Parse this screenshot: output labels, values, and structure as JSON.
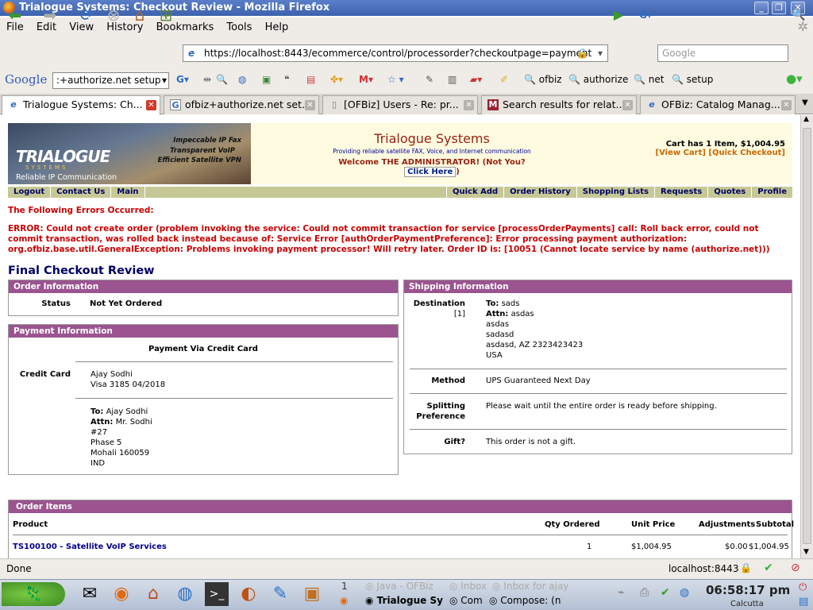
{
  "window": {
    "title": "Trialogue Systems: Checkout Review - Mozilla Firefox"
  },
  "menu": [
    "File",
    "Edit",
    "View",
    "History",
    "Bookmarks",
    "Tools",
    "Help"
  ],
  "nav": {
    "url": "https://localhost:8443/ecommerce/control/processorder?checkoutpage=payment",
    "search_placeholder": "Google"
  },
  "googlebar": {
    "logo": "Google",
    "query": ":+authorize.net setup",
    "links": [
      "ofbiz",
      "authorize",
      "net",
      "setup"
    ]
  },
  "tabs": [
    {
      "label": "Trialogue Systems: Ch...",
      "active": true
    },
    {
      "label": "ofbiz+authorize.net set...",
      "active": false
    },
    {
      "label": "[OFBiz] Users - Re: pr...",
      "active": false
    },
    {
      "label": "Search results for relat...",
      "active": false
    },
    {
      "label": "OFBiz: Catalog Manag...",
      "active": false
    }
  ],
  "page": {
    "logo": {
      "title": "TRIALOGUE",
      "sub": "SYSTEMS",
      "tagline": "Reliable IP Communication",
      "q1": "Impeccable IP Fax",
      "q2": "Transparent VoIP",
      "q3": "Efficient Satellite VPN"
    },
    "store": {
      "name": "Trialogue Systems",
      "slogan": "Providing reliable satellite FAX, Voice, and Internet communication",
      "welcome": "Welcome THE ADMINISTRATOR! (Not You?",
      "click_here": "Click Here",
      "welcome_end": ")"
    },
    "cart": {
      "summary": "Cart has 1 Item, $1,004.95",
      "links": "[View Cart] [Quick Checkout]"
    },
    "nav_left": [
      "Logout",
      "Contact Us",
      "Main"
    ],
    "nav_right": [
      "Quick Add",
      "Order History",
      "Shopping Lists",
      "Requests",
      "Quotes",
      "Profile"
    ],
    "errors_title": "The Following Errors Occurred:",
    "error_text": "ERROR: Could not create order (problem invoking the service: Could not commit transaction for service [processOrderPayments] call: Roll back error, could not commit transaction, was rolled back instead because of: Service Error [authOrderPaymentPreference]: Error processing payment authorization: org.ofbiz.base.util.GeneralException: Problems invoking payment processor! Will retry later. Order ID is: [10051 (Cannot locate service by name (authorize.net)))",
    "review_title": "Final Checkout Review",
    "order_info": {
      "header": "Order Information",
      "status_label": "Status",
      "status_value": "Not Yet Ordered"
    },
    "payment": {
      "header": "Payment Information",
      "via": "Payment Via Credit Card",
      "cc_label": "Credit Card",
      "cc_name": "Ajay  Sodhi",
      "cc_number": "Visa 3185 04/2018",
      "to_label": "To:",
      "to_name": "Ajay Sodhi",
      "attn_label": "Attn:",
      "attn_name": "Mr. Sodhi",
      "line1": "#27",
      "line2": "Phase 5",
      "line3": "Mohali 160059",
      "line4": "IND"
    },
    "shipping": {
      "header": "Shipping Information",
      "dest_label": "Destination",
      "dest_num": "[1]",
      "to_label": "To:",
      "to_name": "sads",
      "attn_label": "Attn:",
      "attn_name": "asdas",
      "line1": "asdas",
      "line2": "sadasd",
      "line3": "asdasd, AZ 2323423423",
      "line4": "USA",
      "method_label": "Method",
      "method_value": "UPS Guaranteed Next Day",
      "split_label1": "Splitting",
      "split_label2": "Preference",
      "split_value": "Please wait until the entire order is ready before shipping.",
      "gift_label": "Gift?",
      "gift_value": "This order is not a gift."
    },
    "items": {
      "header": "Order Items",
      "columns": [
        "Product",
        "Qty Ordered",
        "Unit Price",
        "Adjustments",
        "Subtotal"
      ],
      "row": {
        "product": "TS100100 - Satellite VoIP Services",
        "qty": "1",
        "unit": "$1,004.95",
        "adj": "$0.00",
        "subtotal": "$1,004.95"
      }
    }
  },
  "status": {
    "left": "Done",
    "host": "localhost:8443"
  },
  "taskbar": {
    "workspace": "1",
    "task1": "Java - OFBiz",
    "task2": "Inbox",
    "task3": "Inbox for ajay",
    "task4": "Trialogue Sy",
    "task5": "Com",
    "task6": "Compose: (n",
    "time": "06:58:17 pm",
    "city": "Calcutta"
  }
}
